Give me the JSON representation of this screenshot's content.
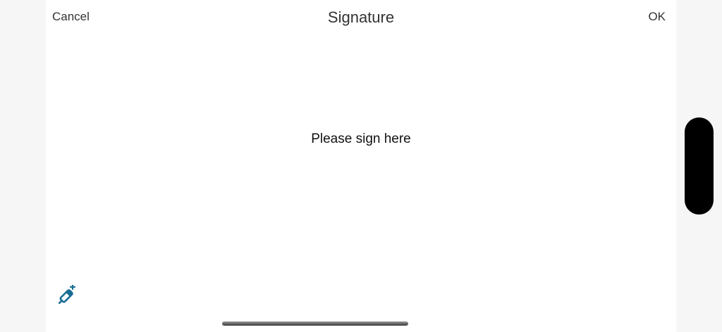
{
  "header": {
    "cancel_label": "Cancel",
    "title": "Signature",
    "ok_label": "OK"
  },
  "canvas": {
    "prompt": "Please sign here"
  },
  "tools": {
    "pen_icon": "pen-icon",
    "pen_color": "#1a6d95"
  }
}
